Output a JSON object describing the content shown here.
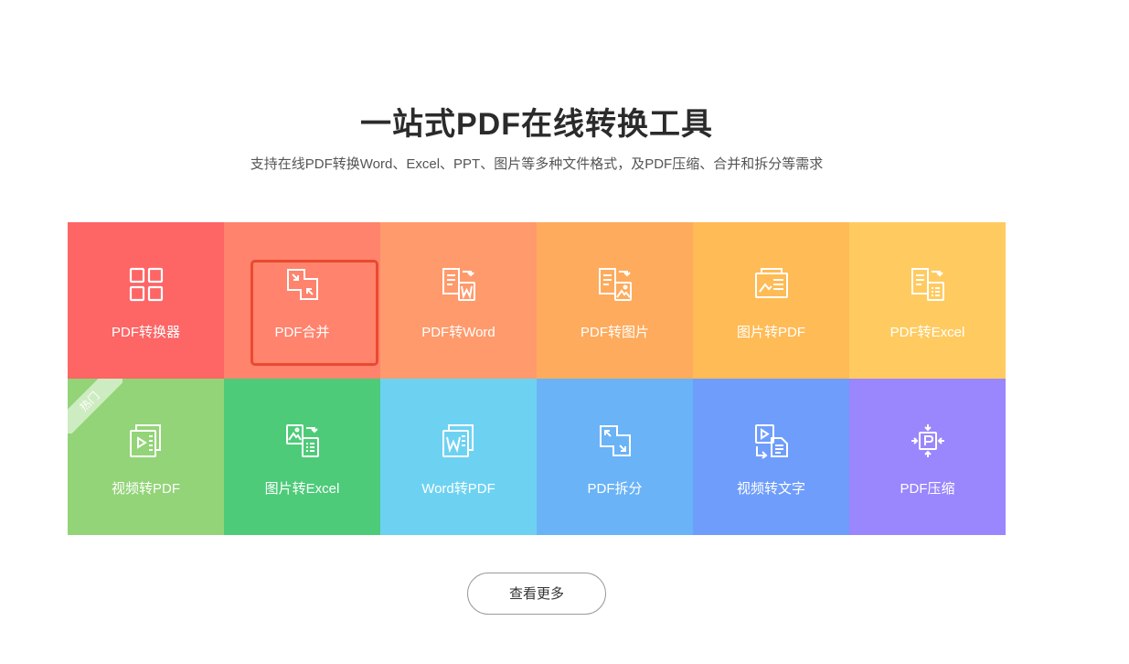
{
  "header": {
    "title": "一站式PDF在线转换工具",
    "subtitle": "支持在线PDF转换Word、Excel、PPT、图片等多种文件格式，及PDF压缩、合并和拆分等需求"
  },
  "tools": [
    {
      "label": "PDF转换器",
      "icon": "grid-icon",
      "color": "#fe6565"
    },
    {
      "label": "PDF合并",
      "icon": "merge-icon",
      "color": "#ff836d",
      "selected": true
    },
    {
      "label": "PDF转Word",
      "icon": "pdf-to-word-icon",
      "color": "#ff9a6c"
    },
    {
      "label": "PDF转图片",
      "icon": "pdf-to-image-icon",
      "color": "#feab5d"
    },
    {
      "label": "图片转PDF",
      "icon": "image-to-pdf-icon",
      "color": "#ffbb55"
    },
    {
      "label": "PDF转Excel",
      "icon": "pdf-to-excel-icon",
      "color": "#ffcb60"
    },
    {
      "label": "视频转PDF",
      "icon": "video-to-pdf-icon",
      "color": "#92d477",
      "badge": "热门"
    },
    {
      "label": "图片转Excel",
      "icon": "image-to-excel-icon",
      "color": "#4dcb79"
    },
    {
      "label": "Word转PDF",
      "icon": "word-to-pdf-icon",
      "color": "#6dd2f2"
    },
    {
      "label": "PDF拆分",
      "icon": "split-icon",
      "color": "#6ab3f7"
    },
    {
      "label": "视频转文字",
      "icon": "video-to-text-icon",
      "color": "#6f9dfb"
    },
    {
      "label": "PDF压缩",
      "icon": "compress-icon",
      "color": "#9a86fd"
    }
  ],
  "more_button": {
    "label": "查看更多"
  }
}
